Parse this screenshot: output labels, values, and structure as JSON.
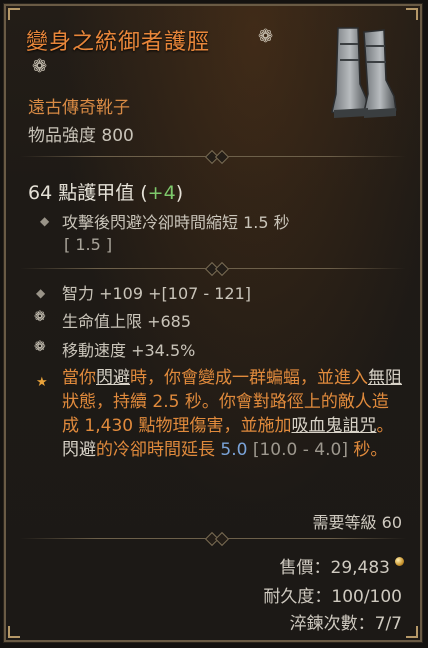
{
  "item": {
    "name": "變身之統御者護脛",
    "rarity_type": "遠古傳奇靴子",
    "power": "物品強度 800",
    "armor_text": "64 點護甲值",
    "armor_bonus": "+4",
    "implicit_affix": "攻擊後閃避冷卻時間縮短 1.5 秒",
    "implicit_range": "[ 1.5 ]",
    "affix_1": "智力 +109 +[107 - 121]",
    "affix_2": "生命值上限 +685",
    "affix_3": "移動速度 +34.5%",
    "legendary": {
      "p1": "當你",
      "evade1": "閃避",
      "p2": "時，你會變成一群蝙蝠，並進入",
      "unhindered": "無阻",
      "p3": "狀態，持續 2.5 秒。你會對路徑上的敵人造成 1,430 點物理傷害，並施加",
      "vampiric_curse": "吸血鬼詛咒",
      "p4": "。",
      "evade2": "閃避",
      "p5": "的冷卻時間延長 ",
      "value": "5.0",
      "range": " [10.0 - 4.0] ",
      "p6": "秒。"
    },
    "required_level": "需要等級 60",
    "sell_price": "售價：29,483",
    "durability": "耐久度：100/100",
    "tempers": "淬鍊次數：7/7"
  },
  "colors": {
    "title": "#e8863a",
    "legendary_text": "#e08a3c",
    "armor_bonus": "#7ec96b",
    "highlight_value": "#7aa3d8"
  }
}
